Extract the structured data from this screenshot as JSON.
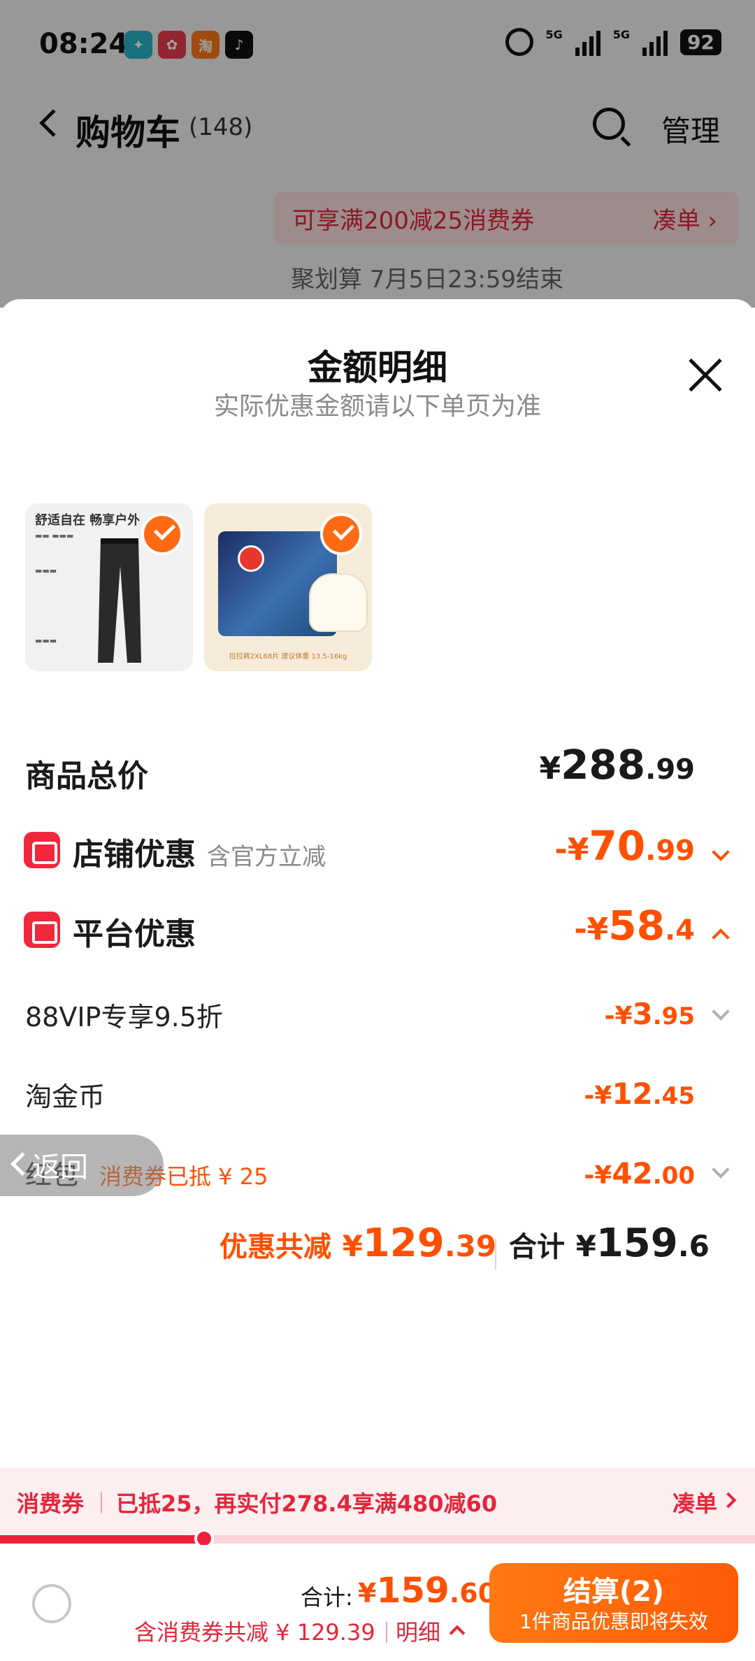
{
  "status_bar": {
    "time": "08:24",
    "app_icons": [
      "camel-app",
      "food-app",
      "taobao-app",
      "tiktok-app"
    ],
    "signal_tag_1": "5G",
    "signal_tag_2": "5G",
    "battery": "92"
  },
  "background_page": {
    "nav_title": "购物车",
    "item_count": "(148)",
    "manage_label": "管理",
    "promo_text": "可享满200减25消费券",
    "promo_link": "凑单 ›",
    "juhuasuan": "聚划算 7月5日23:59结束"
  },
  "sheet": {
    "title": "金额明细",
    "subtitle": "实际优惠金额请以下单页为准",
    "products": [
      {
        "headline": "舒适自在 畅享户外",
        "selected": true
      },
      {
        "footer": "拉拉裤2XL68片 建议体重 13.5-16kg",
        "selected": true
      }
    ],
    "rows": {
      "total": {
        "label": "商品总价",
        "yen": "¥",
        "int": "288",
        "dec": ".99"
      },
      "shop_discount": {
        "label": "店铺优惠",
        "note": "含官方立减",
        "yen": "-¥",
        "int": "70",
        "dec": ".99"
      },
      "platform_discount": {
        "label": "平台优惠",
        "yen": "-¥",
        "int": "58",
        "dec": ".4"
      },
      "vip": {
        "label": "88VIP专享9.5折",
        "yen": "-¥",
        "int": "3",
        "dec": ".95"
      },
      "coins": {
        "label": "淘金币",
        "yen": "-¥",
        "int": "12",
        "dec": ".45"
      },
      "redpacket": {
        "label": "红包",
        "note": "消费券已抵 ¥ 25",
        "yen": "-¥",
        "int": "42",
        "dec": ".00"
      }
    },
    "summary": {
      "discount_label": "优惠共减",
      "discount_yen": "¥",
      "discount_int": "129",
      "discount_dec": ".39",
      "total_label": "合计",
      "total_yen": "¥",
      "total_int": "159",
      "total_dec": ".6"
    },
    "back_pill": "返回"
  },
  "coupon_bar": {
    "label": "消费券",
    "message": "已抵25，再实付278.4享满480减60",
    "link": "凑单",
    "progress": 0.27
  },
  "checkout": {
    "sum_label": "合计:",
    "sum_yen": "¥",
    "sum_int": "159",
    "sum_dec": ".60",
    "sum_note": "含消费券共减 ¥ 129.39",
    "detail_label": "明细",
    "button_main": "结算(2)",
    "button_sub": "1件商品优惠即将失效"
  },
  "colors": {
    "accent_orange": "#ff5000",
    "accent_red": "#e4263b"
  }
}
